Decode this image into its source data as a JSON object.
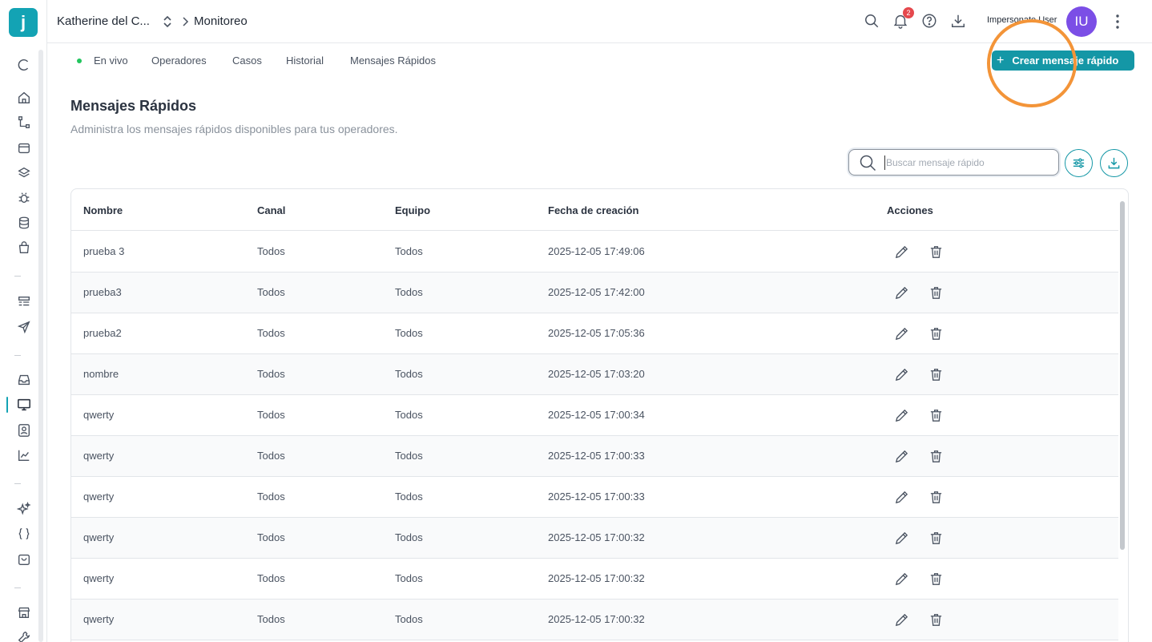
{
  "app": {
    "logo_letter": "j"
  },
  "header": {
    "org_name": "Katherine del C...",
    "breadcrumb": "Monitoreo",
    "notification_count": "2",
    "impersonate_label": "Impersonate User",
    "avatar_initials": "IU"
  },
  "tabs": [
    {
      "label": "En vivo"
    },
    {
      "label": "Operadores"
    },
    {
      "label": "Casos"
    },
    {
      "label": "Historial"
    },
    {
      "label": "Mensajes Rápidos"
    }
  ],
  "create_button": {
    "label": "Crear mensaje rápido"
  },
  "page": {
    "title": "Mensajes Rápidos",
    "subtitle": "Administra los mensajes rápidos disponibles para tus operadores."
  },
  "search": {
    "placeholder": "Buscar mensaje rápido",
    "value": ""
  },
  "table": {
    "columns": [
      "Nombre",
      "Canal",
      "Equipo",
      "Fecha de creación",
      "Acciones"
    ],
    "rows": [
      {
        "nombre": "prueba 3",
        "canal": "Todos",
        "equipo": "Todos",
        "fecha": "2025-12-05 17:49:06"
      },
      {
        "nombre": "prueba3",
        "canal": "Todos",
        "equipo": "Todos",
        "fecha": "2025-12-05 17:42:00"
      },
      {
        "nombre": "prueba2",
        "canal": "Todos",
        "equipo": "Todos",
        "fecha": "2025-12-05 17:05:36"
      },
      {
        "nombre": "nombre",
        "canal": "Todos",
        "equipo": "Todos",
        "fecha": "2025-12-05 17:03:20"
      },
      {
        "nombre": "qwerty",
        "canal": "Todos",
        "equipo": "Todos",
        "fecha": "2025-12-05 17:00:34"
      },
      {
        "nombre": "qwerty",
        "canal": "Todos",
        "equipo": "Todos",
        "fecha": "2025-12-05 17:00:33"
      },
      {
        "nombre": "qwerty",
        "canal": "Todos",
        "equipo": "Todos",
        "fecha": "2025-12-05 17:00:33"
      },
      {
        "nombre": "qwerty",
        "canal": "Todos",
        "equipo": "Todos",
        "fecha": "2025-12-05 17:00:32"
      },
      {
        "nombre": "qwerty",
        "canal": "Todos",
        "equipo": "Todos",
        "fecha": "2025-12-05 17:00:32"
      },
      {
        "nombre": "qwerty",
        "canal": "Todos",
        "equipo": "Todos",
        "fecha": "2025-12-05 17:00:32"
      }
    ]
  },
  "colors": {
    "accent": "#1497a6",
    "live": "#22c55e",
    "badge": "#e5484d",
    "avatar": "#7b4ee6",
    "annotation": "#f39438"
  },
  "sidebar_icons": [
    "refresh-icon",
    "home-icon",
    "flow-icon",
    "inbox-tray-icon",
    "layers-icon",
    "bug-icon",
    "database-icon",
    "shopping-bag-icon",
    "list-icon",
    "send-icon",
    "inbox-icon",
    "monitor-icon",
    "contact-icon",
    "chart-line-icon",
    "sparkles-icon",
    "code-braces-icon",
    "cart-icon",
    "store-icon",
    "tool-icon"
  ]
}
